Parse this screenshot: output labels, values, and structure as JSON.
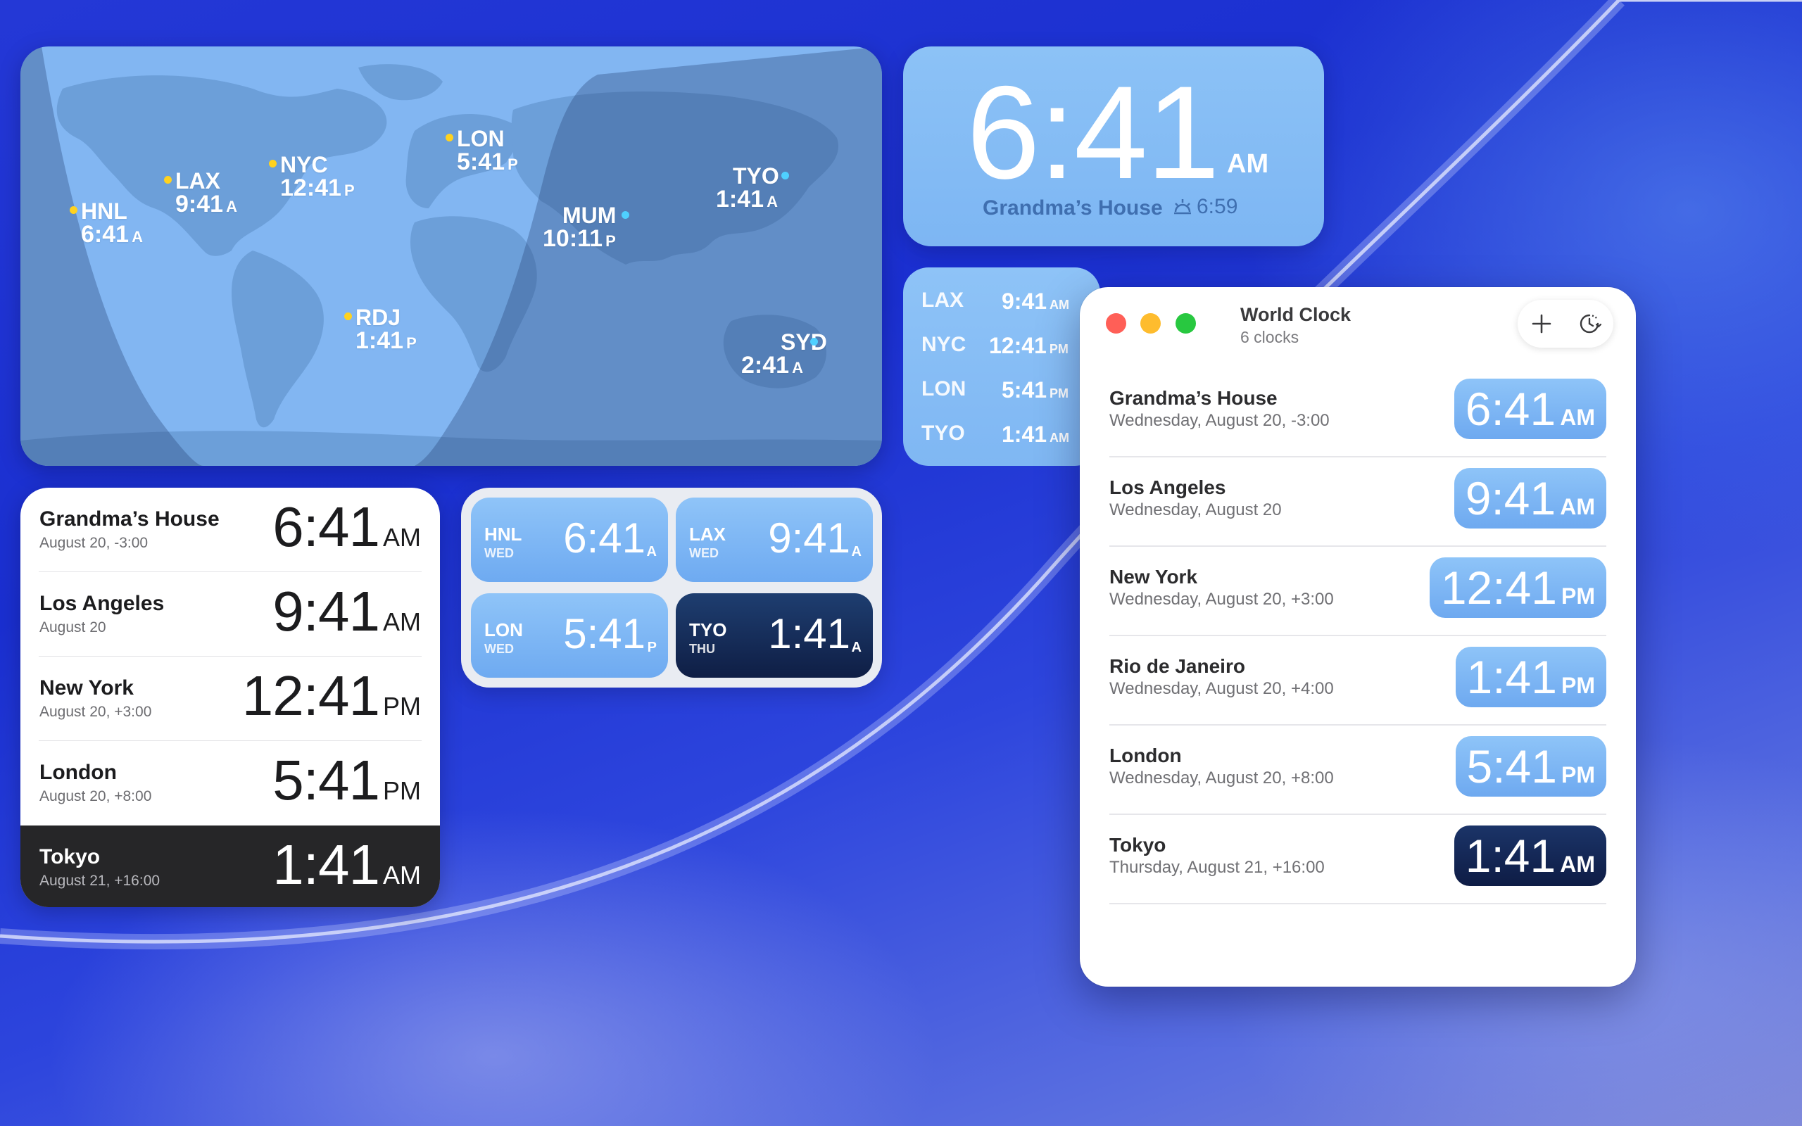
{
  "map": {
    "cities": [
      {
        "code": "HNL",
        "time": "6:41",
        "suffix": "A",
        "phase": "day"
      },
      {
        "code": "LAX",
        "time": "9:41",
        "suffix": "A",
        "phase": "day"
      },
      {
        "code": "NYC",
        "time": "12:41",
        "suffix": "P",
        "phase": "day"
      },
      {
        "code": "LON",
        "time": "5:41",
        "suffix": "P",
        "phase": "day"
      },
      {
        "code": "MUM",
        "time": "10:11",
        "suffix": "P",
        "phase": "night"
      },
      {
        "code": "TYO",
        "time": "1:41",
        "suffix": "A",
        "phase": "night"
      },
      {
        "code": "RDJ",
        "time": "1:41",
        "suffix": "P",
        "phase": "day"
      },
      {
        "code": "SYD",
        "time": "2:41",
        "suffix": "A",
        "phase": "night"
      }
    ]
  },
  "big_clock": {
    "time": "6:41",
    "ampm": "AM",
    "place": "Grandma’s House",
    "sunrise": "6:59",
    "sunrise_icon": "sunrise-icon"
  },
  "small_list": {
    "rows": [
      {
        "code": "LAX",
        "time": "9:41",
        "suffix": "AM"
      },
      {
        "code": "NYC",
        "time": "12:41",
        "suffix": "PM"
      },
      {
        "code": "LON",
        "time": "5:41",
        "suffix": "PM"
      },
      {
        "code": "TYO",
        "time": "1:41",
        "suffix": "AM"
      }
    ]
  },
  "list_widget": {
    "rows": [
      {
        "name": "Grandma’s House",
        "sub": "August 20, -3:00",
        "time": "6:41",
        "ampm": "AM"
      },
      {
        "name": "Los Angeles",
        "sub": "August 20",
        "time": "9:41",
        "ampm": "AM"
      },
      {
        "name": "New York",
        "sub": "August 20, +3:00",
        "time": "12:41",
        "ampm": "PM"
      },
      {
        "name": "London",
        "sub": "August 20, +8:00",
        "time": "5:41",
        "ampm": "PM"
      },
      {
        "name": "Tokyo",
        "sub": "August 21, +16:00",
        "time": "1:41",
        "ampm": "AM"
      }
    ]
  },
  "grid_widget": {
    "tiles": [
      {
        "code": "HNL",
        "day": "WED",
        "time": "6:41",
        "suffix": "A"
      },
      {
        "code": "LAX",
        "day": "WED",
        "time": "9:41",
        "suffix": "A"
      },
      {
        "code": "LON",
        "day": "WED",
        "time": "5:41",
        "suffix": "P"
      },
      {
        "code": "TYO",
        "day": "THU",
        "time": "1:41",
        "suffix": "A"
      }
    ]
  },
  "window": {
    "title": "World Clock",
    "subtitle": "6 clocks",
    "add_icon": "plus-icon",
    "history_icon": "clock-history-icon",
    "rows": [
      {
        "name": "Grandma’s House",
        "sub": "Wednesday, August 20, -3:00",
        "time": "6:41",
        "ampm": "AM"
      },
      {
        "name": "Los Angeles",
        "sub": "Wednesday, August 20",
        "time": "9:41",
        "ampm": "AM"
      },
      {
        "name": "New York",
        "sub": "Wednesday, August 20, +3:00",
        "time": "12:41",
        "ampm": "PM"
      },
      {
        "name": "Rio de Janeiro",
        "sub": "Wednesday, August 20, +4:00",
        "time": "1:41",
        "ampm": "PM"
      },
      {
        "name": "London",
        "sub": "Wednesday, August 20, +8:00",
        "time": "5:41",
        "ampm": "PM"
      },
      {
        "name": "Tokyo",
        "sub": "Thursday, August 21, +16:00",
        "time": "1:41",
        "ampm": "AM"
      }
    ]
  },
  "colors": {
    "accent_blue": "#7db6f3",
    "night_tile": "#0f1e45",
    "day_dot": "#ffd21f",
    "night_dot": "#4fd0ff"
  }
}
